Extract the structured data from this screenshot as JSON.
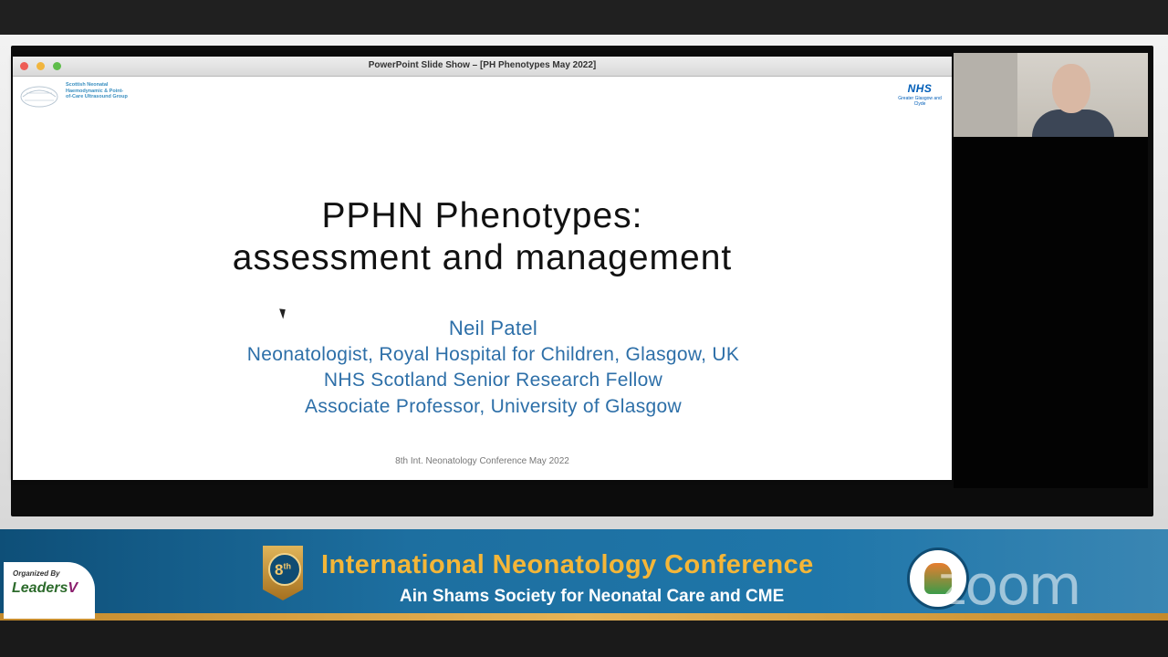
{
  "window": {
    "title": "PowerPoint Slide Show – [PH Phenotypes May 2022]"
  },
  "slide": {
    "logo_left_text": "Scottish Neonatal Haemodynamic & Point-of-Care Ultrasound Group",
    "nhs_logo": "NHS",
    "nhs_sub": "Greater Glasgow and Clyde",
    "title_line1": "PPHN Phenotypes:",
    "title_line2": "assessment and management",
    "presenter_name": "Neil Patel",
    "presenter_role1": "Neonatologist, Royal Hospital for Children, Glasgow, UK",
    "presenter_role2": "NHS Scotland Senior Research Fellow",
    "presenter_role3": "Associate Professor, University of Glasgow",
    "footer": "8th Int. Neonatology Conference May 2022"
  },
  "banner": {
    "organized_by": "Organized By",
    "org_name": "Leaders",
    "org_mark": "V",
    "badge_number": "8",
    "badge_suffix": "th",
    "title": "International Neonatology Conference",
    "subtitle": "Ain Shams Society for Neonatal Care and CME",
    "watermark": "zoom"
  }
}
